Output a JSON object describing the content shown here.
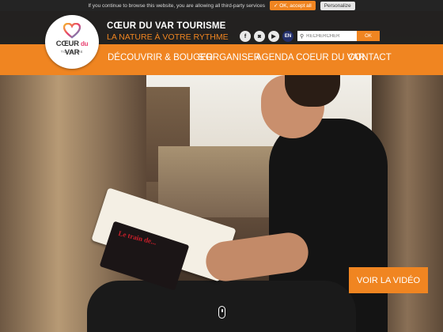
{
  "cookie_bar": {
    "message": "If you continue to browse this website, you are allowing all third-party services",
    "accept_label": "✓ OK, accept all",
    "personalize_label": "Personalize"
  },
  "logo": {
    "word_main": "CŒUR",
    "word_du": "du",
    "word_var": "VAR",
    "small": "TOURISME"
  },
  "brand": {
    "title": "CŒUR DU VAR TOURISME",
    "subtitle": "LA NATURE À VOTRE RYTHME"
  },
  "socials": [
    {
      "icon": "facebook-icon",
      "glyph": "f"
    },
    {
      "icon": "instagram-icon",
      "glyph": "◙"
    },
    {
      "icon": "youtube-icon",
      "glyph": "▶"
    },
    {
      "icon": "english-flag-icon",
      "glyph": "EN"
    }
  ],
  "search": {
    "placeholder": "RECHERCHER",
    "ok_label": "OK"
  },
  "nav": {
    "items": [
      "DÉCOUVRIR & BOUGER",
      "S'ORGANISER",
      "AGENDA COEUR DU VAR",
      "CONTACT"
    ]
  },
  "hero": {
    "book_title": "Le train de..."
  },
  "cta": {
    "video_label": "VOIR LA VIDÉO"
  },
  "colors": {
    "accent": "#f08521",
    "dark": "#1c1c1c"
  }
}
